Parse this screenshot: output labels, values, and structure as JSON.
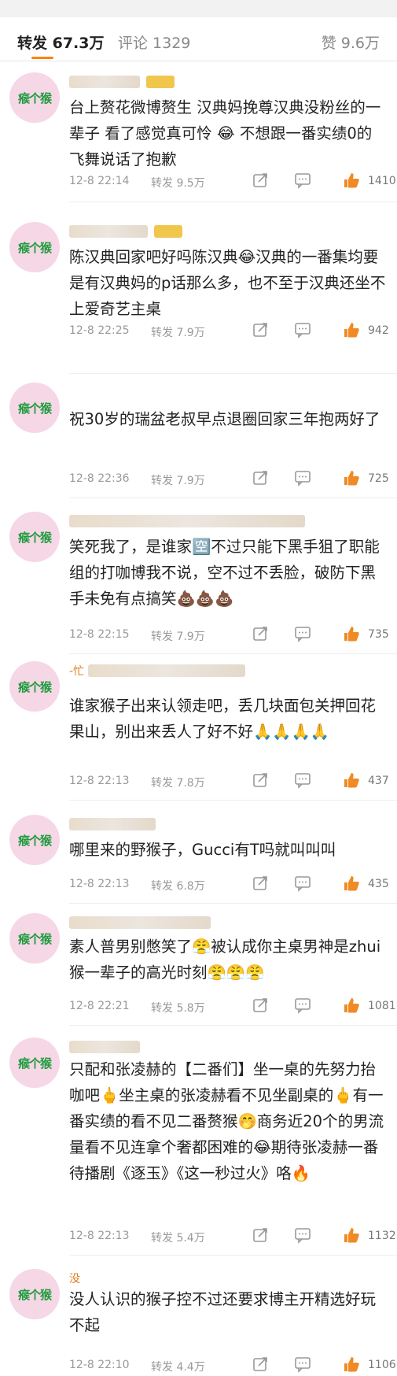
{
  "tabs": {
    "repost": "转发 67.3万",
    "comment": "评论 1329",
    "like": "赞 9.6万"
  },
  "avatar_text": "瘊个猴",
  "colors": {
    "accent": "#ff8200",
    "avatar_bg": "#f6d7e5",
    "avatar_text": "#1e9b3f"
  },
  "comments": [
    {
      "text": "台上赘花微博赘生 汉典妈挽尊汉典没粉丝的一辈子 看了感觉真可怜 😂 不想跟一番实绩0的飞舞说话了抱歉",
      "time": "12-8 22:14",
      "repost": "转发 9.5万",
      "likes": "1410"
    },
    {
      "text": "陈汉典回家吧好吗陈汉典😂汉典的一番集均要是有汉典妈的p话那么多，也不至于汉典还坐不上爱奇艺主桌",
      "time": "12-8 22:25",
      "repost": "转发 7.9万",
      "likes": "942"
    },
    {
      "text": "祝30岁的瑞盆老叔早点退圈回家三年抱两好了",
      "time": "12-8 22:36",
      "repost": "转发 7.9万",
      "likes": "725"
    },
    {
      "text": "笑死我了，是谁家🈳不过只能下黑手狙了职能组的打咖博我不说，空不过不丢脸，破防下黑手未免有点搞笑💩💩💩",
      "time": "12-8 22:15",
      "repost": "转发 7.9万",
      "likes": "735"
    },
    {
      "uname": "-忙",
      "text": "谁家猴子出来认领走吧，丢几块面包关押回花果山，别出来丢人了好不好🙏🙏🙏🙏",
      "time": "12-8 22:13",
      "repost": "转发 7.8万",
      "likes": "437"
    },
    {
      "text": "哪里来的野猴子，Gucci有T吗就叫叫叫",
      "time": "12-8 22:13",
      "repost": "转发 6.8万",
      "likes": "435"
    },
    {
      "text": "素人普男别憋笑了😤被认成你主桌男神是zhui猴一辈子的高光时刻😤😤😤",
      "time": "12-8 22:21",
      "repost": "转发 5.8万",
      "likes": "1081"
    },
    {
      "text": "只配和张凌赫的【二番们】坐一桌的先努力抬咖吧🖕坐主桌的张凌赫看不见坐副桌的🖕有一番实绩的看不见二番赘猴🤭商务近20个的男流量看不见连拿个奢都困难的😂期待张凌赫一番待播剧《逐玉》《这一秒过火》咯🔥",
      "time": "12-8 22:13",
      "repost": "转发 5.4万",
      "likes": "1132"
    },
    {
      "uname": "没",
      "text": "没人认识的猴子控不过还要求博主开精选好玩不起",
      "time": "12-8 22:10",
      "repost": "转发 4.4万",
      "likes": "1106"
    }
  ]
}
